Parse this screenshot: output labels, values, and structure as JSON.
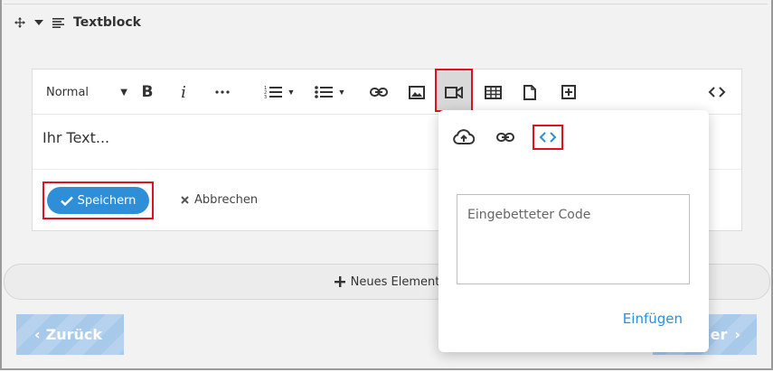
{
  "header": {
    "title": "Textblock",
    "move_icon": "move-icon",
    "collapse_icon": "caret-down-icon",
    "block_icon": "lines-icon"
  },
  "toolbar": {
    "format_value": "Normal",
    "icons": [
      "bold-icon",
      "italic-icon",
      "more-icon",
      "ordered-list-icon",
      "bullet-list-icon",
      "link-icon",
      "image-icon",
      "video-icon",
      "table-icon",
      "file-icon",
      "add-box-icon",
      "code-icon"
    ],
    "bold": "B",
    "italic": "i"
  },
  "editor": {
    "content": "Ihr Text..."
  },
  "actions": {
    "save_label": "Speichern",
    "cancel_label": "Abbrechen"
  },
  "new_element_label": "Neues Element",
  "navigation": {
    "back_label": "Zurück",
    "next_label": "er"
  },
  "embed_popup": {
    "tabs": [
      "upload-icon",
      "link-icon",
      "code-icon"
    ],
    "placeholder": "Eingebetteter Code",
    "insert_label": "Einfügen"
  },
  "colors": {
    "accent": "#2e8fd8",
    "highlight": "#e0121f",
    "nav": "#a7c9ea"
  }
}
